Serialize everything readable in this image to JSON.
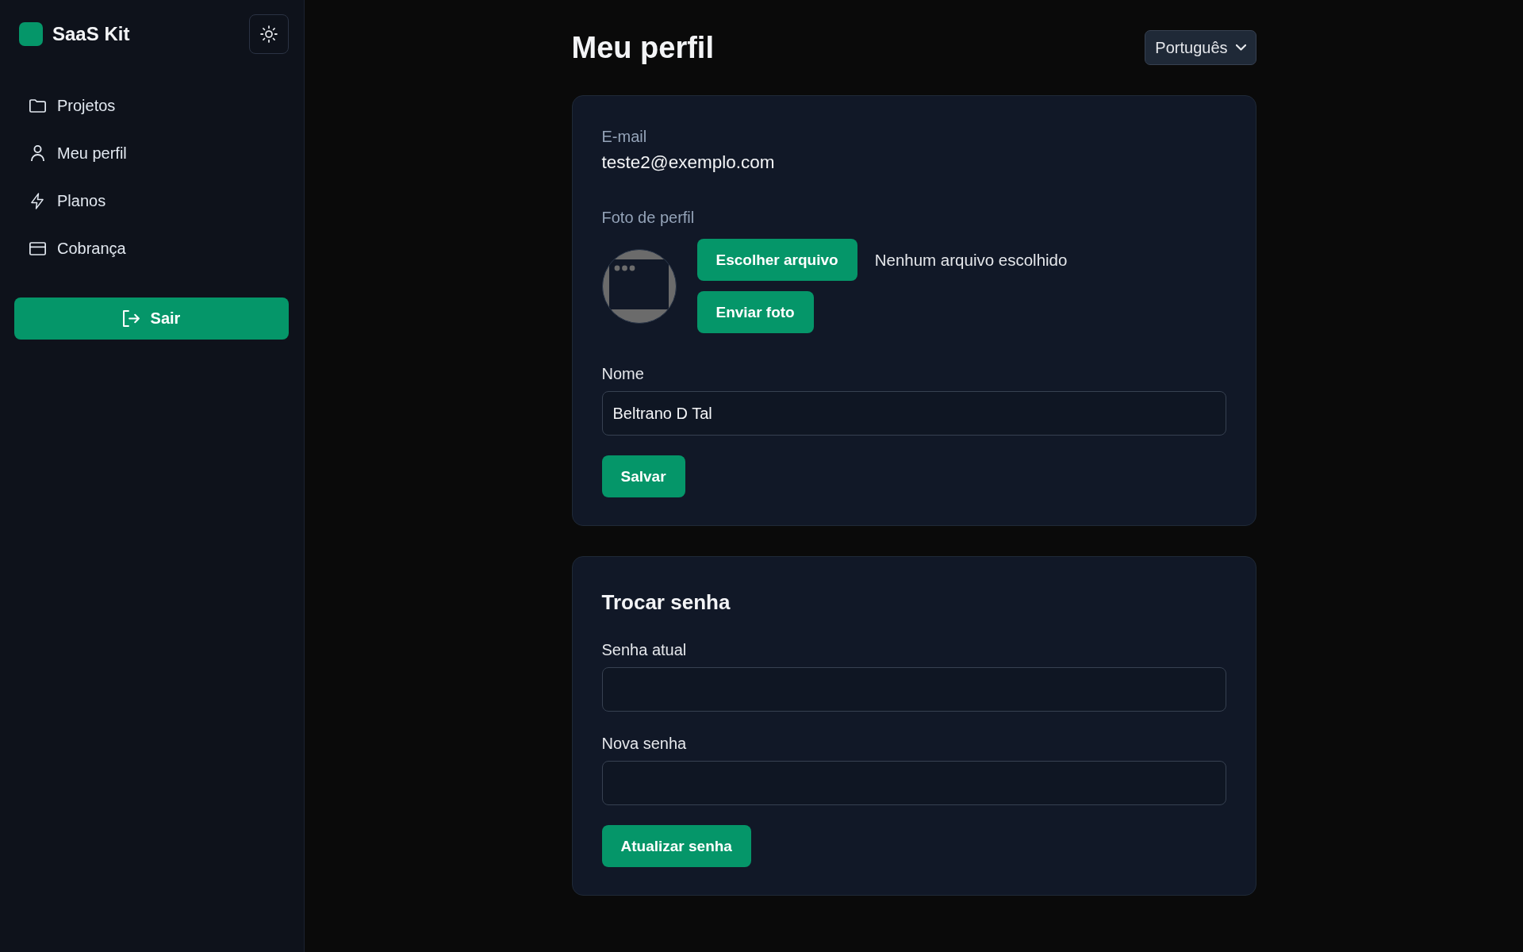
{
  "sidebar": {
    "brand": "SaaS Kit",
    "nav_items": [
      {
        "label": "Projetos"
      },
      {
        "label": "Meu perfil"
      },
      {
        "label": "Planos"
      },
      {
        "label": "Cobrança"
      }
    ],
    "logout_button": "Sair"
  },
  "header": {
    "title": "Meu perfil",
    "language_select": {
      "value": "Português"
    }
  },
  "profile_card": {
    "email": {
      "label": "E-mail",
      "value": "teste2@exemplo.com"
    },
    "photo": {
      "label": "Foto de perfil",
      "choose_button": "Escolher arquivo",
      "file_status": "Nenhum arquivo escolhido",
      "upload_button": "Enviar foto"
    },
    "name_field": {
      "label": "Nome",
      "value": "Beltrano D Tal"
    },
    "save_button": "Salvar"
  },
  "password_card": {
    "title": "Trocar senha",
    "fields": [
      {
        "label": "Senha atual"
      },
      {
        "label": "Nova senha"
      }
    ],
    "submit_button": "Atualizar senha"
  }
}
